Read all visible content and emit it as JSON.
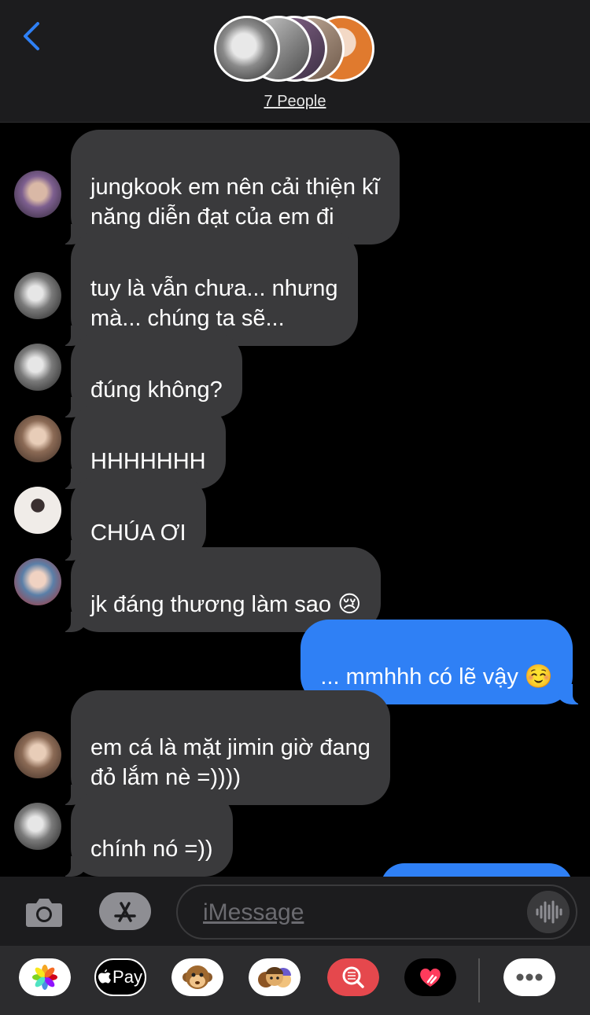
{
  "header": {
    "back_icon": "chevron-left-icon",
    "people_label": "7 People",
    "accent_color": "#2f80f5"
  },
  "messages": [
    {
      "dir": "in",
      "text": "jungkook em nên cải thiện kĩ\nnăng diễn đạt của em đi",
      "avatar": "avatar-purple-hair"
    },
    {
      "dir": "in",
      "text": "tuy là vẫn chưa... nhưng\nmà... chúng ta sẽ...",
      "avatar": "avatar-monochrome"
    },
    {
      "dir": "in",
      "text": "đúng không?",
      "avatar": "avatar-monochrome"
    },
    {
      "dir": "in",
      "text": "HHHHHHH",
      "avatar": "avatar-warm"
    },
    {
      "dir": "in",
      "text": "CHÚA ƠI",
      "avatar": "avatar-white-sweater"
    },
    {
      "dir": "in",
      "text": "jk đáng thương làm sao 😢",
      "avatar": "avatar-blue-jacket"
    },
    {
      "dir": "out",
      "text": "... mmhhh có lẽ vậy ☺️"
    },
    {
      "dir": "in",
      "text": "em cá là mặt jimin giờ đang\nđỏ lắm nè =))))",
      "avatar": "avatar-warm"
    },
    {
      "dir": "in",
      "text": "chính nó =))",
      "avatar": "avatar-monochrome"
    }
  ],
  "input": {
    "placeholder": "iMessage",
    "camera_icon": "camera-icon",
    "apps_icon": "app-store-icon",
    "voice_icon": "waveform-icon"
  },
  "app_strip": [
    {
      "name": "photos-app-icon"
    },
    {
      "name": "apple-pay-app-icon",
      "label": "Pay"
    },
    {
      "name": "animoji-app-icon"
    },
    {
      "name": "memoji-app-icon"
    },
    {
      "name": "image-search-app-icon"
    },
    {
      "name": "digital-touch-app-icon"
    },
    {
      "name": "more-apps-icon"
    }
  ],
  "colors": {
    "bubble_in": "#3a3a3c",
    "bubble_out": "#2f80f5",
    "bar_bg": "#1c1c1e"
  }
}
